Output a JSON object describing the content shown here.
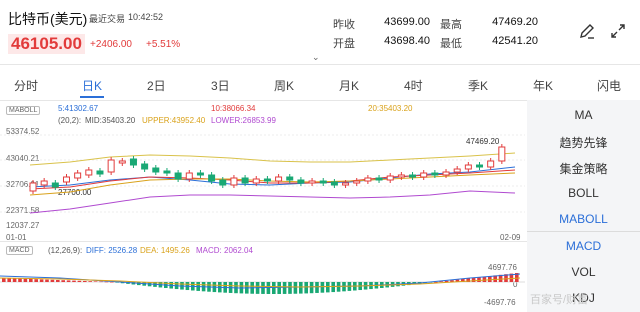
{
  "header": {
    "title": "比特币(美元)",
    "trade_label": "最近交易",
    "trade_time": "10:42:52",
    "price": "46105.00",
    "change": "+2406.00",
    "change_pct": "+5.51%",
    "prev_close_label": "昨收",
    "prev_close": "43699.00",
    "high_label": "最高",
    "high": "47469.20",
    "open_label": "开盘",
    "open": "43698.40",
    "low_label": "最低",
    "low": "42541.20"
  },
  "tabs": [
    "分时",
    "日K",
    "2日",
    "3日",
    "周K",
    "月K",
    "4时",
    "季K",
    "年K",
    "闪电"
  ],
  "active_tab": "日K",
  "main_chart": {
    "tag": "MABOLL",
    "boll_params": "(20,2):",
    "mid_label": "MID:35403.20",
    "upper_label": "UPPER:43952.40",
    "lower_label": "LOWER:26853.99",
    "time_marks": [
      "5:41302.67",
      "10:38066.34",
      "20:35403.20"
    ],
    "y_ticks": [
      "53374.52",
      "43040.21",
      "32706.91",
      "22371.58",
      "12037.27"
    ],
    "date_start": "01-01",
    "date_end": "02-09",
    "high_annot": "47469.20",
    "low_annot": "27700.00"
  },
  "macd": {
    "tag": "MACD",
    "params": "(12,26,9):",
    "diff": "DIFF: 2526.28",
    "dea": "DEA: 1495.26",
    "macd": "MACD: 2062.04",
    "top": "4697.76",
    "zero": "0",
    "bottom": "-4697.76"
  },
  "sidebar": [
    "MA",
    "趋势先锋",
    "集金策略",
    "BOLL",
    "MABOLL",
    "MACD",
    "VOL",
    "KDJ"
  ],
  "sidebar_active": [
    "MABOLL",
    "MACD"
  ],
  "watermark": "百家号/财富",
  "colors": {
    "up": "#e23b3b",
    "down": "#19a874",
    "accent": "#2b6fd8"
  },
  "chart_data": {
    "type": "candlestick",
    "ylim": [
      12037.27,
      53374.52
    ],
    "high": 47469.2,
    "low": 27700.0,
    "last": 46105.0
  }
}
